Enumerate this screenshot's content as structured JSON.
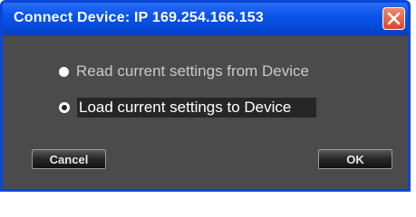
{
  "window": {
    "title": "Connect Device: IP 169.254.166.153",
    "close_icon": "close-icon"
  },
  "options": [
    {
      "label": "Read current settings from Device",
      "selected": false
    },
    {
      "label": "Load current settings to Device",
      "selected": true
    }
  ],
  "buttons": {
    "cancel_label": "Cancel",
    "ok_label": "OK"
  },
  "colors": {
    "titlebar": "#0a54e8",
    "body": "#4b4b4b",
    "close_button": "#d9462a"
  }
}
